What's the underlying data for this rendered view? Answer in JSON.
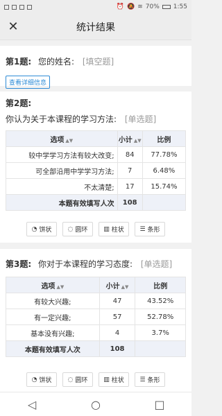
{
  "status": {
    "battery": "70%",
    "time": "1:55"
  },
  "header": {
    "title": "统计结果",
    "close_icon": "close-icon"
  },
  "q1": {
    "num": "第1题:",
    "text": "您的姓名:",
    "type": "[填空题]",
    "detail_btn": "查看详细信息"
  },
  "q2": {
    "num": "第2题:",
    "text": "你认为关于本课程的学习方法:",
    "type": "[单选题]",
    "headers": {
      "option": "选项",
      "count": "小计",
      "ratio": "比例"
    },
    "rows": [
      {
        "option": "较中学学习方法有较大改变;",
        "count": "84",
        "ratio": "77.78%"
      },
      {
        "option": "可全部沿用中学学习方法;",
        "count": "7",
        "ratio": "6.48%"
      },
      {
        "option": "不太清楚;",
        "count": "17",
        "ratio": "15.74%"
      }
    ],
    "total_label": "本题有效填写人次",
    "total_value": "108"
  },
  "q3": {
    "num": "第3题:",
    "text": "你对于本课程的学习态度:",
    "type": "[单选题]",
    "headers": {
      "option": "选项",
      "count": "小计",
      "ratio": "比例"
    },
    "rows": [
      {
        "option": "有较大兴趣;",
        "count": "47",
        "ratio": "43.52%"
      },
      {
        "option": "有一定兴趣;",
        "count": "57",
        "ratio": "52.78%"
      },
      {
        "option": "基本没有兴趣;",
        "count": "4",
        "ratio": "3.7%"
      }
    ],
    "total_label": "本题有效填写人次",
    "total_value": "108"
  },
  "chart_buttons": {
    "pie": "饼状",
    "ring": "圆环",
    "bar": "柱状",
    "strip": "条形"
  }
}
